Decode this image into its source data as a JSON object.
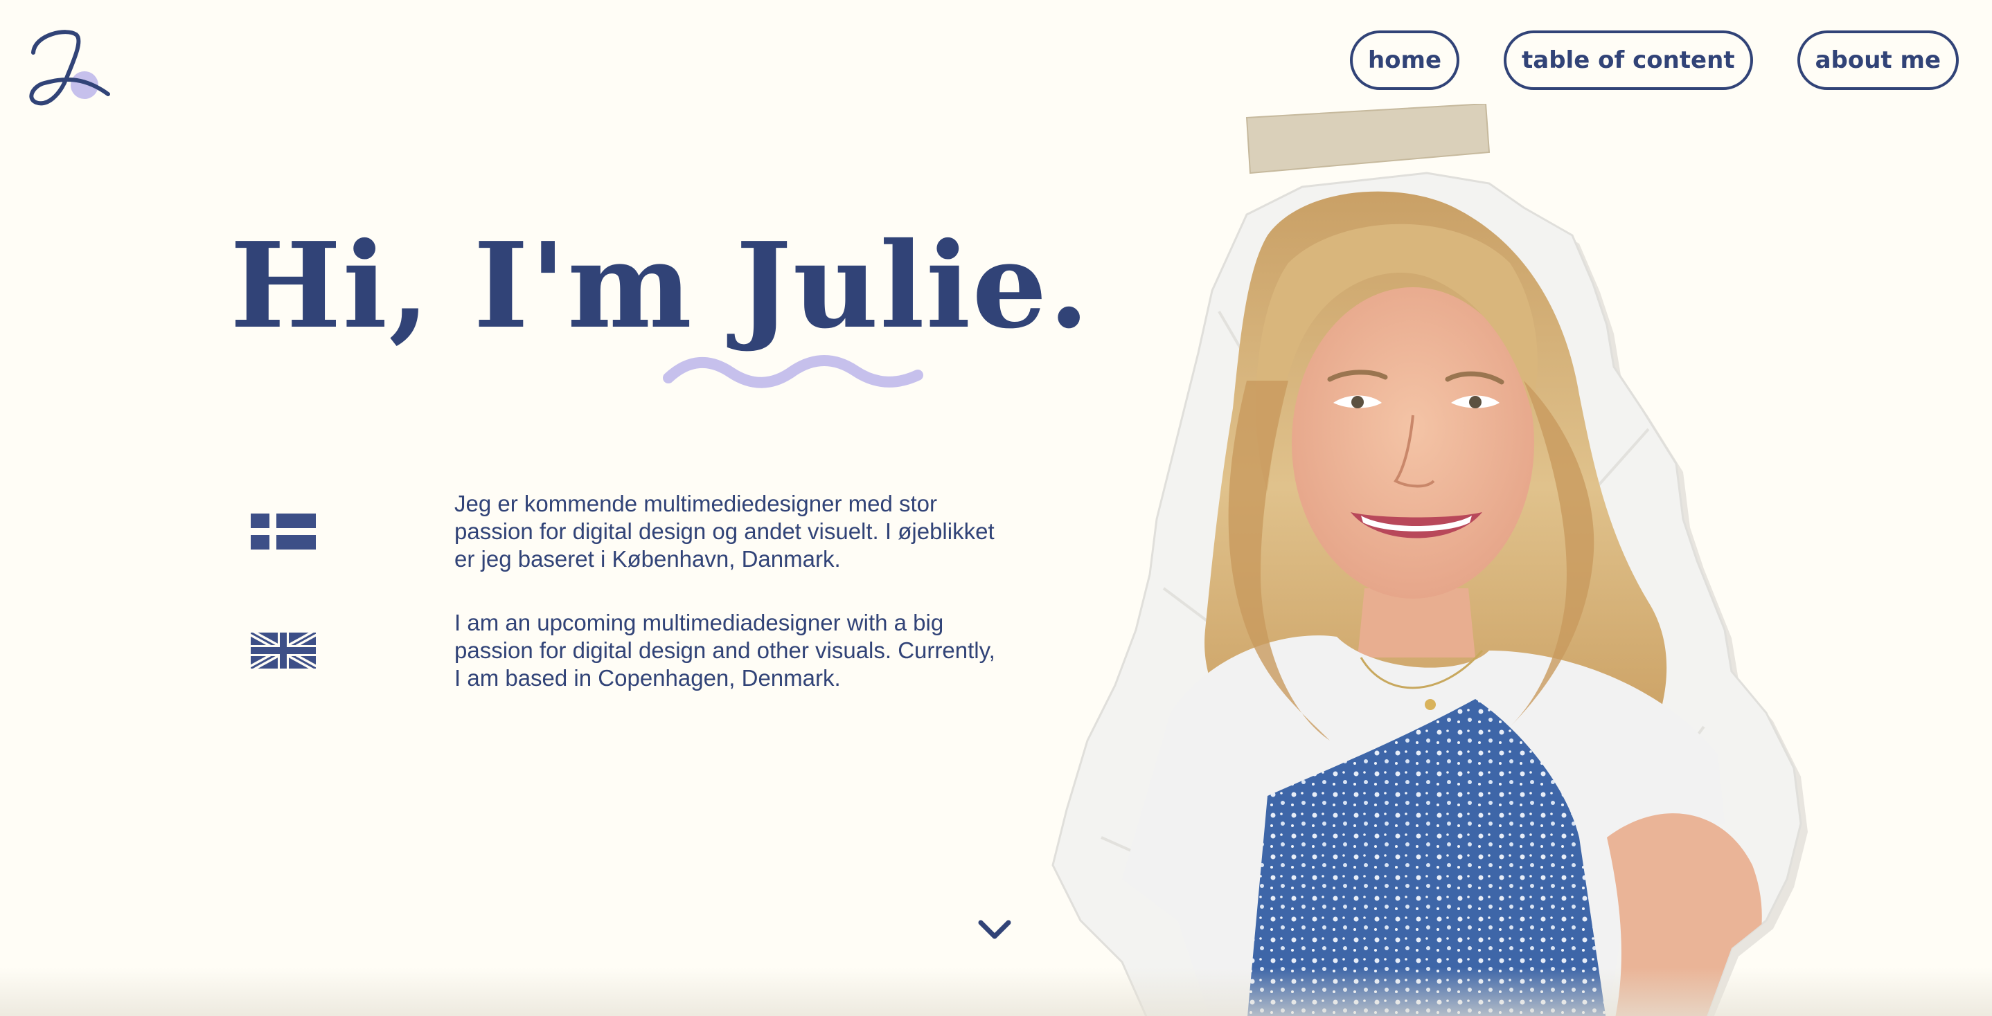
{
  "brand": {
    "logo_icon": "script-j-logo-icon"
  },
  "nav": {
    "items": [
      {
        "label": "home"
      },
      {
        "label": "table of content"
      },
      {
        "label": "about me"
      }
    ]
  },
  "hero": {
    "greeting": "Hi, I'm Julie.",
    "intro": [
      {
        "flag_icon": "danish-flag-icon",
        "text": "Jeg er kommende multimediedesigner med stor\npassion for digital design og andet visuelt. I øjeblikket\ner jeg baseret i København, Danmark."
      },
      {
        "flag_icon": "uk-flag-icon",
        "text": "I am an upcoming multimediadesigner with a big\npassion for digital design and other visuals. Currently,\nI am based in Copenhagen, Denmark."
      }
    ],
    "scroll_icon": "chevron-down-icon",
    "photo_icon": "portrait-photo-icon"
  },
  "colors": {
    "background": "#fffdf6",
    "primary": "#314377",
    "accent": "#c6c0ec",
    "tape": "#d7ccb4"
  }
}
